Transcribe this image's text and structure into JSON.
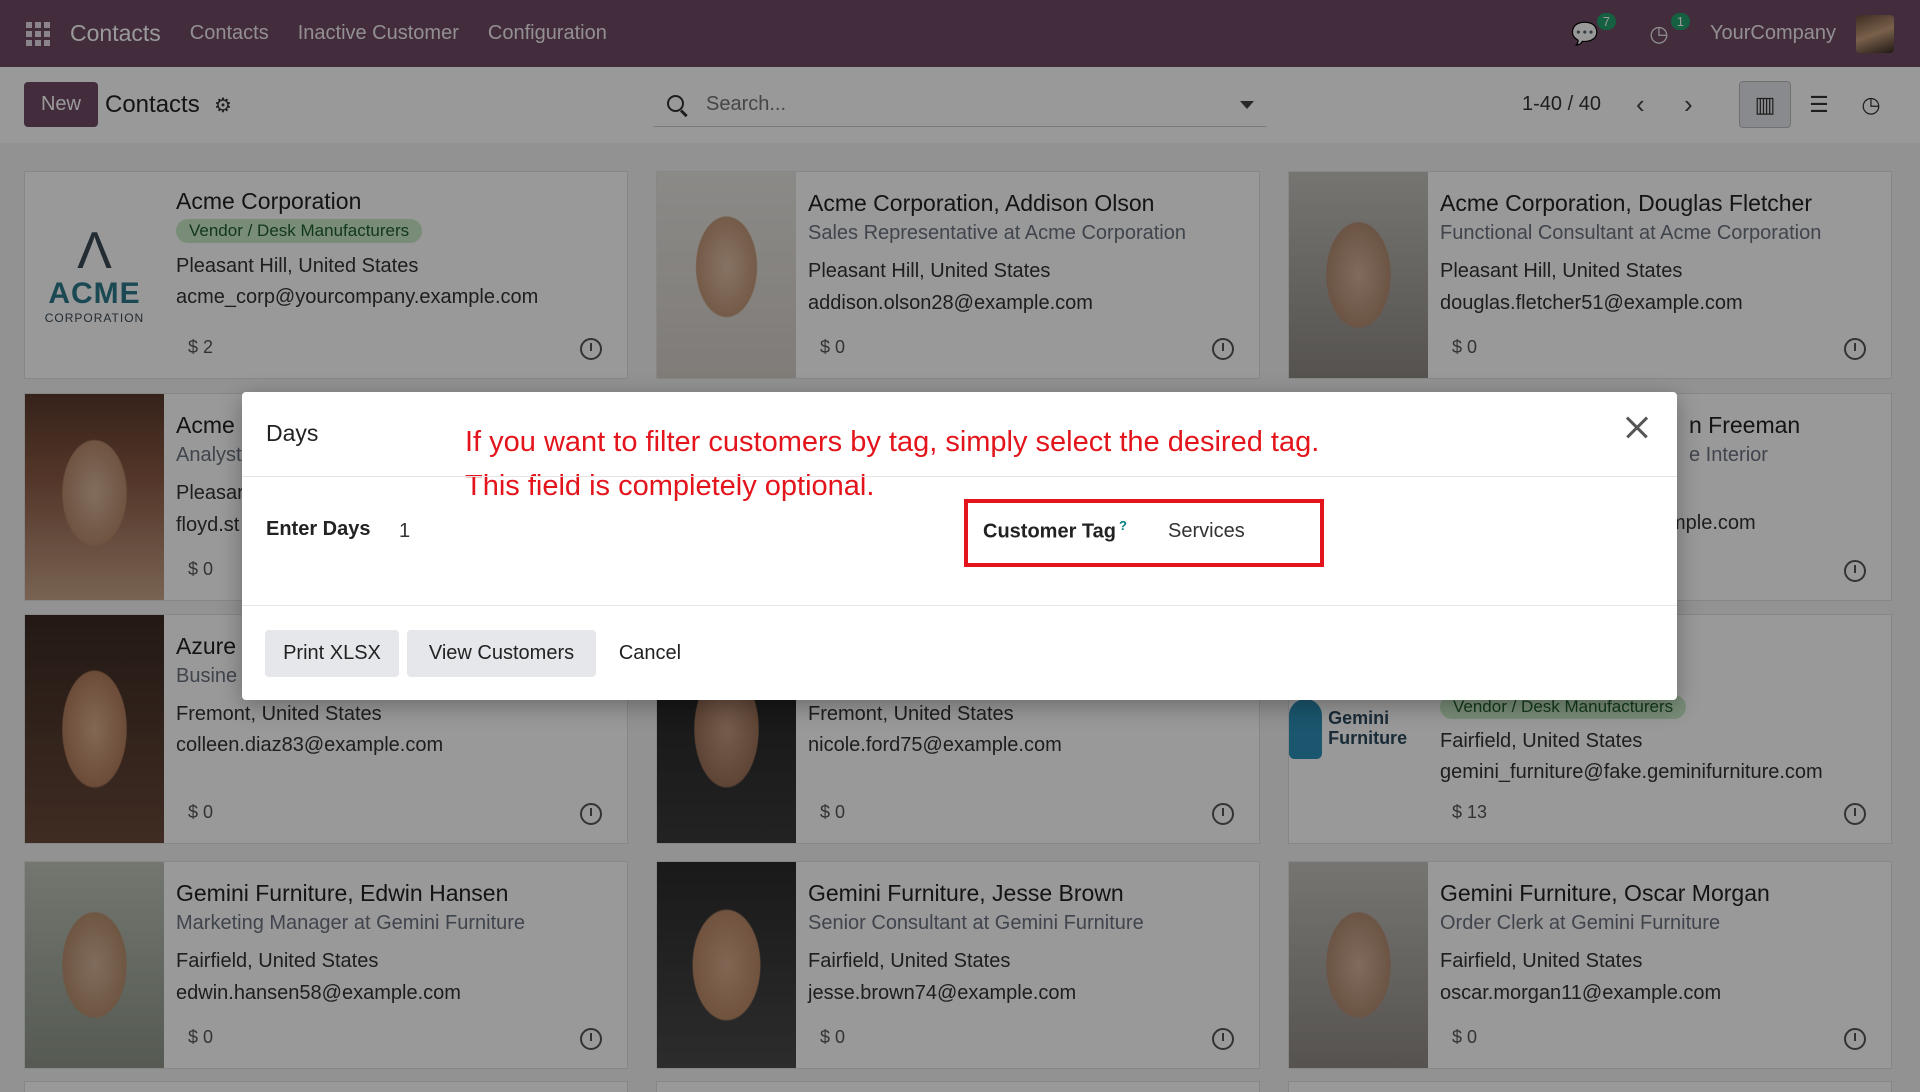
{
  "navbar": {
    "brand": "Contacts",
    "menu": [
      "Contacts",
      "Inactive Customer",
      "Configuration"
    ],
    "chat_badge": "7",
    "activity_badge": "1",
    "company": "YourCompany"
  },
  "control": {
    "new_label": "New",
    "title": "Contacts",
    "search_placeholder": "Search...",
    "pager": "1-40 / 40"
  },
  "cards": [
    {
      "name": "Acme Corporation",
      "tag": "Vendor / Desk Manufacturers",
      "address": "Pleasant Hill, United States",
      "email": "acme_corp@yourcompany.example.com",
      "amount": "$ 2",
      "logo_word": "ACME",
      "logo_corp": "CORPORATION"
    },
    {
      "name": "Acme Corporation, Addison Olson",
      "subtitle": "Sales Representative at Acme Corporation",
      "address": "Pleasant Hill, United States",
      "email": "addison.olson28@example.com",
      "amount": "$ 0"
    },
    {
      "name": "Acme Corporation, Douglas Fletcher",
      "subtitle": "Functional Consultant at Acme Corporation",
      "address": "Pleasant Hill, United States",
      "email": "douglas.fletcher51@example.com",
      "amount": "$ 0"
    },
    {
      "name": "Acme",
      "subtitle": "Analyst",
      "address": "Pleasar",
      "email": "floyd.st",
      "amount": "$ 0"
    },
    {
      "name": "n Freeman",
      "subtitle": "e Interior",
      "email": "mple.com"
    },
    {
      "name": "Azure",
      "subtitle": "Busine",
      "address": "Fremont, United States",
      "email": "colleen.diaz83@example.com",
      "amount": "$ 0"
    },
    {
      "address": "Fremont, United States",
      "email": "nicole.ford75@example.com",
      "amount": "$ 0"
    },
    {
      "tag": "Vendor / Desk Manufacturers",
      "address": "Fairfield, United States",
      "email": "gemini_furniture@fake.geminifurniture.com",
      "amount": "$ 13",
      "logo_word": "Gemini Furniture"
    },
    {
      "name": "Gemini Furniture, Edwin Hansen",
      "subtitle": "Marketing Manager at Gemini Furniture",
      "address": "Fairfield, United States",
      "email": "edwin.hansen58@example.com",
      "amount": "$ 0"
    },
    {
      "name": "Gemini Furniture, Jesse Brown",
      "subtitle": "Senior Consultant at Gemini Furniture",
      "address": "Fairfield, United States",
      "email": "jesse.brown74@example.com",
      "amount": "$ 0"
    },
    {
      "name": "Gemini Furniture, Oscar Morgan",
      "subtitle": "Order Clerk at Gemini Furniture",
      "address": "Fairfield, United States",
      "email": "oscar.morgan11@example.com",
      "amount": "$ 0"
    }
  ],
  "dialog": {
    "title": "Days",
    "note_line1": "If you want to filter customers by tag, simply select the desired tag.",
    "note_line2": "This field is completely optional.",
    "days_label": "Enter Days",
    "days_value": "1",
    "tag_label": "Customer Tag",
    "tag_help": "?",
    "tag_value": "Services",
    "btn_print": "Print XLSX",
    "btn_view": "View Customers",
    "btn_cancel": "Cancel"
  },
  "colors": {
    "brand": "#714b67",
    "annotation": "#e3141b",
    "tag_bg": "#c9e9c6"
  }
}
